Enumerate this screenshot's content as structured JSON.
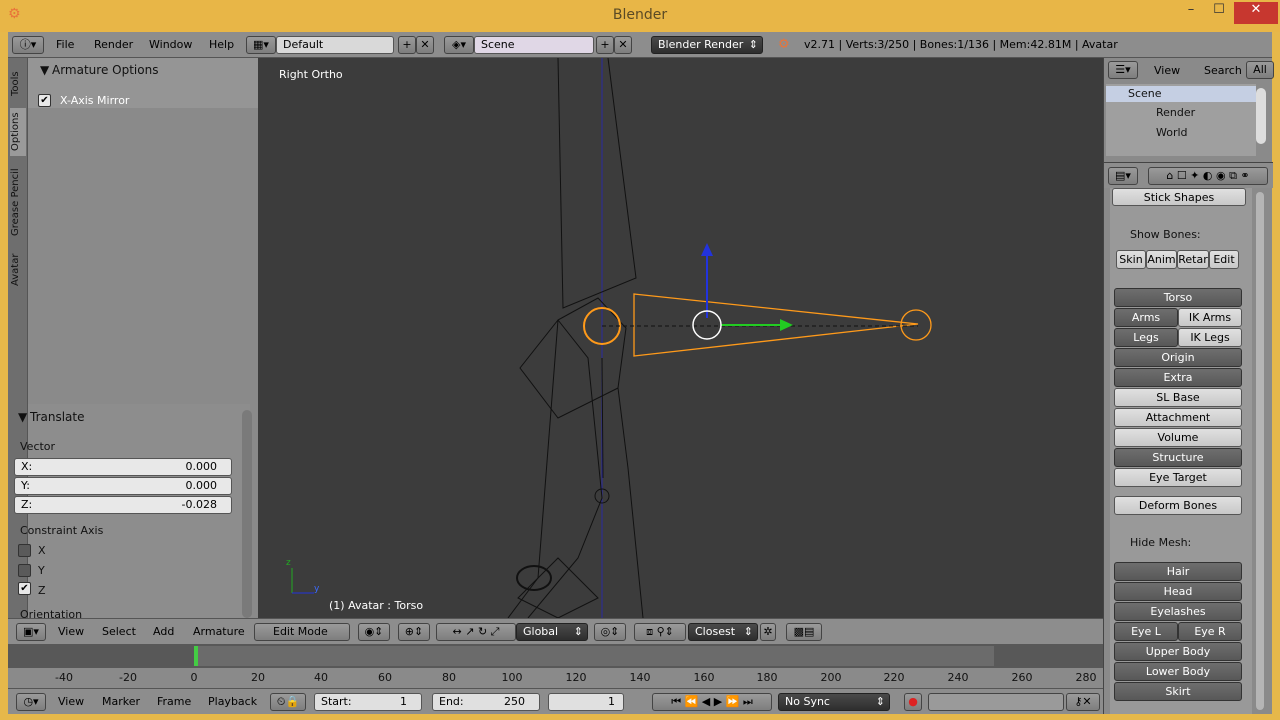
{
  "window": {
    "title": "Blender",
    "min": "–",
    "max": "☐",
    "close": "✕"
  },
  "menubar": {
    "menus": [
      "File",
      "Render",
      "Window",
      "Help"
    ],
    "layout": "Default",
    "scene": "Scene",
    "engine": "Blender Render",
    "stats": "v2.71 | Verts:3/250 | Bones:1/136 | Mem:42.81M | Avatar"
  },
  "toolshelf": {
    "tabs": [
      "Tools",
      "Options",
      "Grease Pencil",
      "Avatar"
    ],
    "armature_panel": "Armature Options",
    "xaxis_mirror": "X-Axis Mirror",
    "translate_panel": "Translate",
    "vector_label": "Vector",
    "x_label": "X:",
    "x_value": "0.000",
    "y_label": "Y:",
    "y_value": "0.000",
    "z_label": "Z:",
    "z_value": "-0.028",
    "constraint_label": "Constraint Axis",
    "cx": "X",
    "cy": "Y",
    "cz": "Z",
    "orientation": "Orientation"
  },
  "viewport": {
    "view_name": "Right Ortho",
    "object_info": "(1) Avatar : Torso",
    "axis_y": "y",
    "axis_z": "z"
  },
  "viewport_header": {
    "menus": [
      "View",
      "Select",
      "Add",
      "Armature"
    ],
    "mode": "Edit Mode",
    "orientation": "Global",
    "snap": "Closest"
  },
  "timeline": {
    "ticks": [
      "-40",
      "-20",
      "0",
      "20",
      "40",
      "60",
      "80",
      "100",
      "120",
      "140",
      "160",
      "180",
      "200",
      "220",
      "240",
      "260",
      "280"
    ],
    "menus": [
      "View",
      "Marker",
      "Frame",
      "Playback"
    ],
    "start_label": "Start:",
    "start_value": "1",
    "end_label": "End:",
    "end_value": "250",
    "current": "1",
    "sync": "No Sync"
  },
  "outliner": {
    "menus": [
      "View",
      "Search"
    ],
    "filter": "All Sc",
    "items": [
      "Scene",
      "Render",
      "World"
    ]
  },
  "properties": {
    "stick_shapes": "Stick Shapes",
    "show_bones": "Show Bones:",
    "bone_tabs": [
      "Skin",
      "Anim",
      "Retar",
      "Edit"
    ],
    "torso": "Torso",
    "arms": "Arms",
    "ik_arms": "IK Arms",
    "legs": "Legs",
    "ik_legs": "IK Legs",
    "origin": "Origin",
    "extra": "Extra",
    "sl_base": "SL Base",
    "attachment": "Attachment",
    "volume": "Volume",
    "structure": "Structure",
    "eye_target": "Eye Target",
    "deform_bones": "Deform Bones",
    "hide_mesh": "Hide Mesh:",
    "hair": "Hair",
    "head": "Head",
    "eyelashes": "Eyelashes",
    "eye_l": "Eye L",
    "eye_r": "Eye R",
    "upper_body": "Upper Body",
    "lower_body": "Lower Body",
    "skirt": "Skirt"
  },
  "colors": {
    "accent": "#e8b647",
    "selected_bone": "#ff9a1a",
    "x_axis": "#22cc22",
    "z_axis": "#2233dd"
  }
}
